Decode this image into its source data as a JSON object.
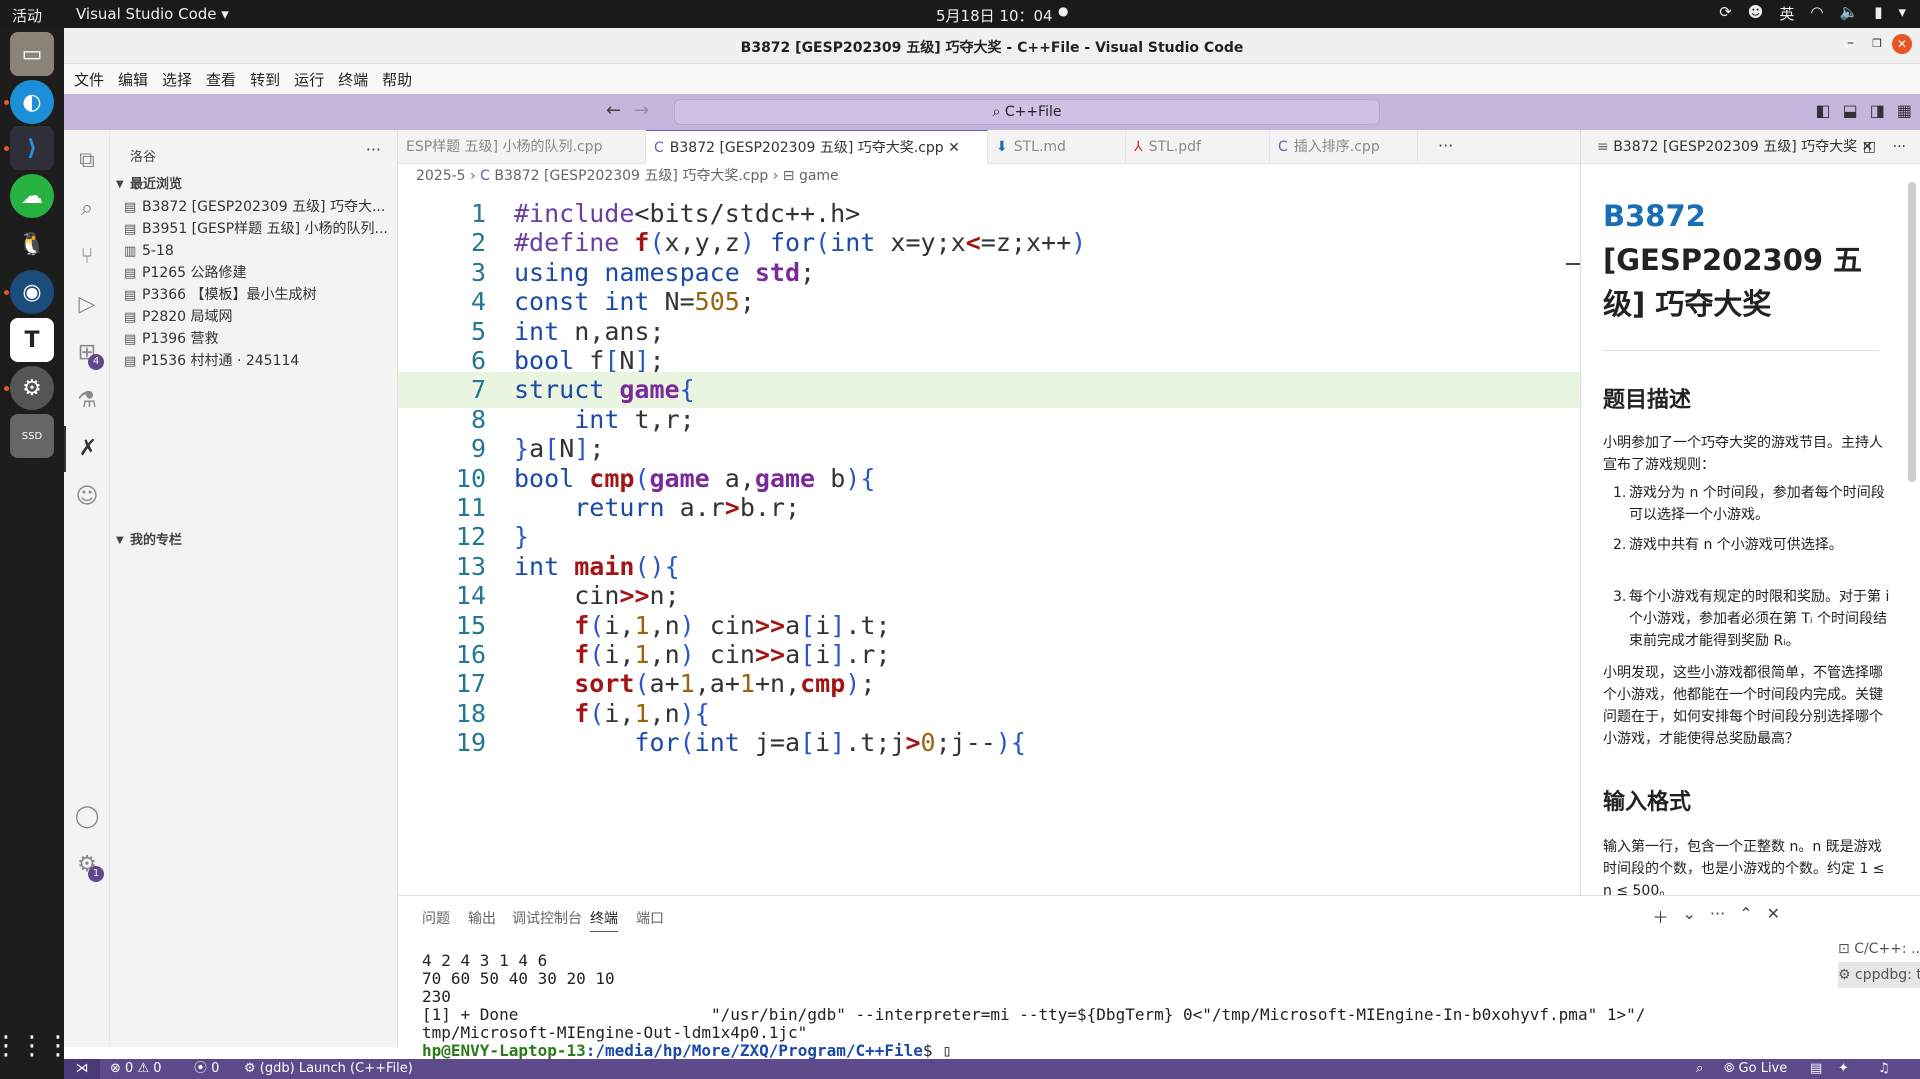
{
  "gnome": {
    "activities": "活动",
    "app_menu": "Visual Studio Code",
    "clock": "5月18日 10：04",
    "input_method": "英"
  },
  "window": {
    "title": "B3872 [GESP202309 五级] 巧夺大奖 - C++File - Visual Studio Code"
  },
  "menu": [
    "文件",
    "编辑",
    "选择",
    "查看",
    "转到",
    "运行",
    "终端",
    "帮助"
  ],
  "command_center": {
    "label": "C++File"
  },
  "sidebar": {
    "title": "洛谷",
    "recent_header": "最近浏览",
    "recent": [
      {
        "label": "B3872 [GESP202309 五级] 巧夺大..."
      },
      {
        "label": "B3951 [GESP样题 五级] 小杨的队列..."
      },
      {
        "label": "5-18"
      },
      {
        "label": "P1265 公路修建"
      },
      {
        "label": "P3366 【模板】最小生成树"
      },
      {
        "label": "P2820 局域网"
      },
      {
        "label": "P1396 营救"
      },
      {
        "label": "P1536 村村通 · 245114"
      }
    ],
    "column_header": "我的专栏"
  },
  "tabs": [
    {
      "label": "ESP样题 五级] 小杨的队列.cpp"
    },
    {
      "label": "B3872 [GESP202309 五级] 巧夺大奖.cpp"
    },
    {
      "label": "STL.md"
    },
    {
      "label": "STL.pdf"
    },
    {
      "label": "插入排序.cpp"
    }
  ],
  "breadcrumb": {
    "folder": "2025-5",
    "file": "B3872 [GESP202309 五级] 巧夺大奖.cpp",
    "symbol": "game"
  },
  "editor": {
    "highlighted_line": 7,
    "lines": [
      {
        "n": "1",
        "text": "#include<bits/stdc++.h>"
      },
      {
        "n": "2",
        "text": "#define f(x,y,z) for(int x=y;x<=z;x++)"
      },
      {
        "n": "3",
        "text": "using namespace std;"
      },
      {
        "n": "4",
        "text": "const int N=505;"
      },
      {
        "n": "5",
        "text": "int n,ans;"
      },
      {
        "n": "6",
        "text": "bool f[N];"
      },
      {
        "n": "7",
        "text": "struct game{"
      },
      {
        "n": "8",
        "text": "    int t,r;"
      },
      {
        "n": "9",
        "text": "}a[N];"
      },
      {
        "n": "10",
        "text": "bool cmp(game a,game b){"
      },
      {
        "n": "11",
        "text": "    return a.r>b.r;"
      },
      {
        "n": "12",
        "text": "}"
      },
      {
        "n": "13",
        "text": "int main(){"
      },
      {
        "n": "14",
        "text": "    cin>>n;"
      },
      {
        "n": "15",
        "text": "    f(i,1,n) cin>>a[i].t;"
      },
      {
        "n": "16",
        "text": "    f(i,1,n) cin>>a[i].r;"
      },
      {
        "n": "17",
        "text": "    sort(a+1,a+1+n,cmp);"
      },
      {
        "n": "18",
        "text": "    f(i,1,n){"
      },
      {
        "n": "19",
        "text": "        for(int j=a[i].t;j>0;j--){"
      }
    ]
  },
  "preview": {
    "tab_label": "B3872 [GESP202309 五级] 巧夺大奖",
    "title_id": "B3872",
    "title_rest": " [GESP202309 五级] 巧夺大奖",
    "h_desc": "题目描述",
    "desc": "小明参加了一个巧夺大奖的游戏节目。主持人宣布了游戏规则：",
    "items": [
      "游戏分为 n 个时间段，参加者每个时间段可以选择一个小游戏。",
      "游戏中共有 n 个小游戏可供选择。",
      "每个小游戏有规定的时限和奖励。对于第 i 个小游戏，参加者必须在第 Tᵢ 个时间段结束前完成才能得到奖励 Rᵢ。"
    ],
    "desc2": "小明发现，这些小游戏都很简单，不管选择哪个小游戏，他都能在一个时间段内完成。关键问题在于，如何安排每个时间段分别选择哪个小游戏，才能使得总奖励最高？",
    "h_input": "输入格式",
    "input_text": "输入第一行，包含一个正整数 n。n 既是游戏时间段的个数，也是小游戏的个数。约定 1 ≤ n ≤ 500。"
  },
  "panel": {
    "tabs": [
      "问题",
      "输出",
      "调试控制台",
      "终端",
      "端口"
    ],
    "active_tab": "终端",
    "terminal_lines": [
      "4 2 4 3 1 4 6",
      "70 60 50 40 30 20 10",
      "230",
      "[1] + Done                    \"/usr/bin/gdb\" --interpreter=mi --tty=${DbgTerm} 0<\"/tmp/Microsoft-MIEngine-In-b0xohyvf.pma\" 1>\"/",
      "tmp/Microsoft-MIEngine-Out-ldm1x4p0.1jc\""
    ],
    "prompt_user": "hp@ENVY-Laptop-13",
    "prompt_path": ":/media/hp/More/ZXQ/Program/C++File",
    "prompt_suffix": "$ ",
    "terminal_list": [
      "C/C++: ...",
      "cppdbg: text"
    ]
  },
  "status": {
    "errors": "0",
    "warnings": "0",
    "ports": "0",
    "debug": "(gdb) Launch (C++File)",
    "golive": "Go Live"
  },
  "badges": {
    "extensions": "4",
    "settings": "1"
  },
  "colors": {
    "statusbar": "#5c4a8a",
    "command_bar": "#c6b6de",
    "accent": "#6c5ba7"
  }
}
